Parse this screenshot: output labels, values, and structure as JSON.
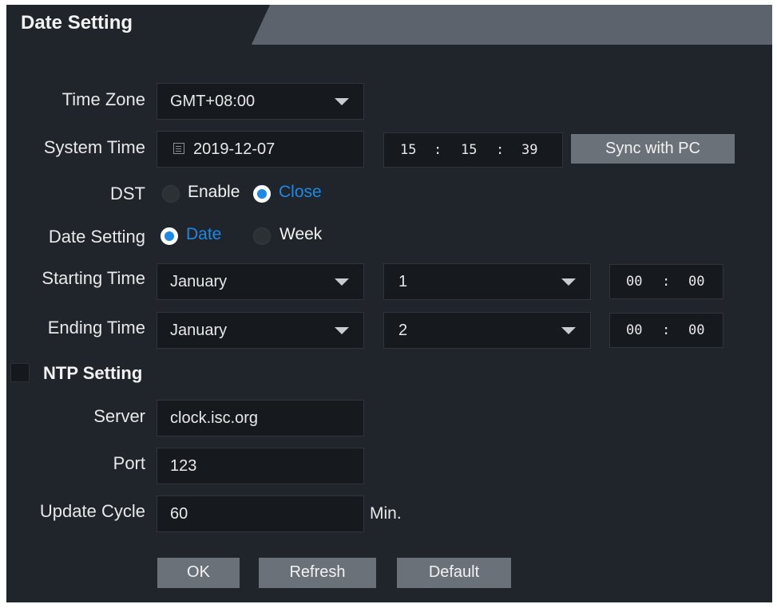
{
  "title": "Date Setting",
  "labels": {
    "time_zone": "Time Zone",
    "system_time": "System Time",
    "dst": "DST",
    "date_setting": "Date Setting",
    "starting_time": "Starting Time",
    "ending_time": "Ending Time",
    "ntp_setting": "NTP Setting",
    "server": "Server",
    "port": "Port",
    "update_cycle": "Update Cycle",
    "min_unit": "Min."
  },
  "time_zone": {
    "selected": "GMT+08:00"
  },
  "system_time": {
    "date": "2019-12-07",
    "hour": "15",
    "minute": "15",
    "second": "39",
    "sep": ":",
    "sync_label": "Sync with PC"
  },
  "dst": {
    "options": [
      "Enable",
      "Close"
    ],
    "selected": "Close"
  },
  "date_setting": {
    "options": [
      "Date",
      "Week"
    ],
    "selected": "Date"
  },
  "starting_time": {
    "month": "January",
    "day": "1",
    "hour": "00",
    "minute": "00",
    "sep": ":"
  },
  "ending_time": {
    "month": "January",
    "day": "2",
    "hour": "00",
    "minute": "00",
    "sep": ":"
  },
  "ntp": {
    "enabled": false,
    "server": "clock.isc.org",
    "port": "123",
    "update_cycle": "60"
  },
  "buttons": {
    "ok": "OK",
    "refresh": "Refresh",
    "default": "Default"
  },
  "colors": {
    "panel_bg": "#20252b",
    "accent": "#1e88e5",
    "button_bg": "#6b7178"
  }
}
